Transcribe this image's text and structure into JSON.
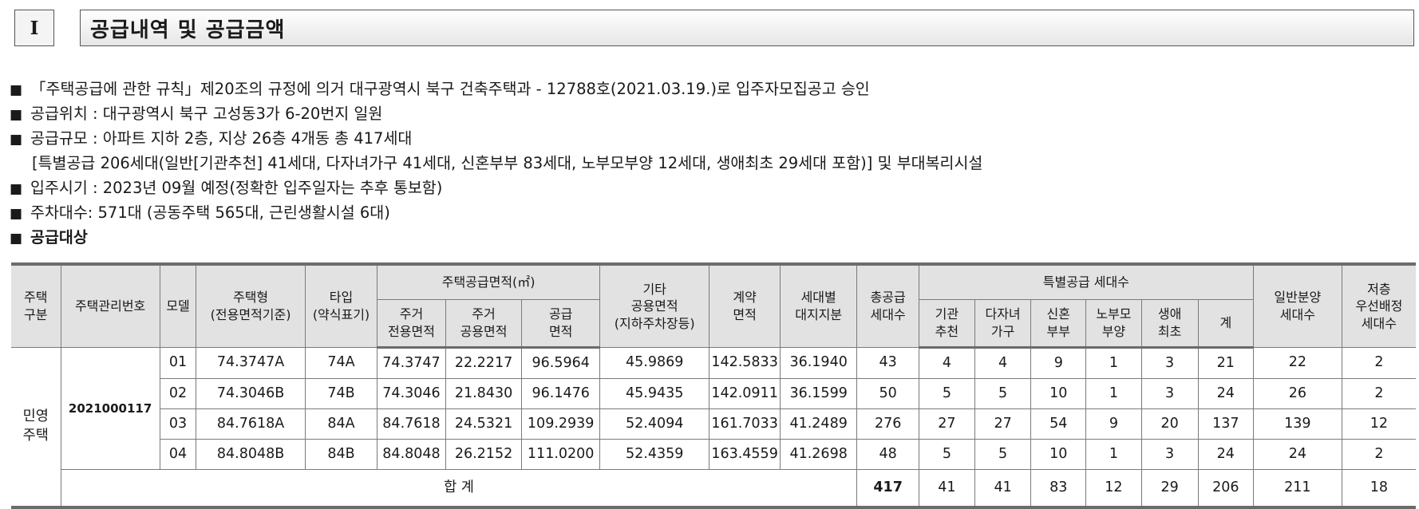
{
  "section": {
    "number": "I",
    "title": "공급내역 및 공급금액"
  },
  "bullets": [
    {
      "marker": "■",
      "text": "「주택공급에 관한 규칙」제20조의 규정에 의거 대구광역시 북구 건축주택과 - 12788호(2021.03.19.)로 입주자모집공고 승인"
    },
    {
      "marker": "■",
      "text": "공급위치 : 대구광역시 북구 고성동3가 6-20번지 일원"
    },
    {
      "marker": "■",
      "text": "공급규모 : 아파트 지하 2층, 지상 26층 4개동 총 417세대"
    },
    {
      "marker": "",
      "text": "[특별공급 206세대(일반[기관추천] 41세대, 다자녀가구 41세대, 신혼부부 83세대, 노부모부양 12세대, 생애최초 29세대 포함)] 및 부대복리시설"
    },
    {
      "marker": "■",
      "text": "입주시기 : 2023년 09월 예정(정확한 입주일자는 추후 통보함)"
    },
    {
      "marker": "■",
      "text": "주차대수: 571대 (공동주택 565대, 근린생활시설 6대)"
    },
    {
      "marker": "■",
      "text": "공급대상"
    }
  ],
  "table": {
    "headers": {
      "housing_type": "주택\n구분",
      "mgmt_no": "주택관리번호",
      "model": "모델",
      "house_type": "주택형\n(전용면적기준)",
      "type": "타입\n(약식표기)",
      "supply_area_group": "주택공급면적(㎡)",
      "exclusive": "주거\n전용면적",
      "common": "주거\n공용면적",
      "supply_area": "공급\n면적",
      "other_common": "기타\n공용면적\n(지하주차장등)",
      "contract_area": "계약\n면적",
      "land_share": "세대별\n대지지분",
      "total_units": "총공급\n세대수",
      "special_group": "특별공급 세대수",
      "inst": "기관\n추천",
      "multi": "다자녀\n가구",
      "newlywed": "신혼\n부부",
      "elderly": "노부모\n부양",
      "first": "생애\n최초",
      "sum": "계",
      "general": "일반분양\n세대수",
      "priority": "저층\n우선배정\n세대수"
    },
    "housing_category": "민영\n주택",
    "management_number": "2021000117",
    "rows": [
      [
        "01",
        "74.3747A",
        "74A",
        "74.3747",
        "22.2217",
        "96.5964",
        "45.9869",
        "142.5833",
        "36.1940",
        "43",
        "4",
        "4",
        "9",
        "1",
        "3",
        "21",
        "22",
        "2"
      ],
      [
        "02",
        "74.3046B",
        "74B",
        "74.3046",
        "21.8430",
        "96.1476",
        "45.9435",
        "142.0911",
        "36.1599",
        "50",
        "5",
        "5",
        "10",
        "1",
        "3",
        "24",
        "26",
        "2"
      ],
      [
        "03",
        "84.7618A",
        "84A",
        "84.7618",
        "24.5321",
        "109.2939",
        "52.4094",
        "161.7033",
        "41.2489",
        "276",
        "27",
        "27",
        "54",
        "9",
        "20",
        "137",
        "139",
        "12"
      ],
      [
        "04",
        "84.8048B",
        "84B",
        "84.8048",
        "26.2152",
        "111.0200",
        "52.4359",
        "163.4559",
        "41.2698",
        "48",
        "5",
        "5",
        "10",
        "1",
        "3",
        "24",
        "24",
        "2"
      ]
    ],
    "total": {
      "label": "합 계",
      "values": [
        "417",
        "41",
        "41",
        "83",
        "12",
        "29",
        "206",
        "211",
        "18"
      ]
    }
  }
}
